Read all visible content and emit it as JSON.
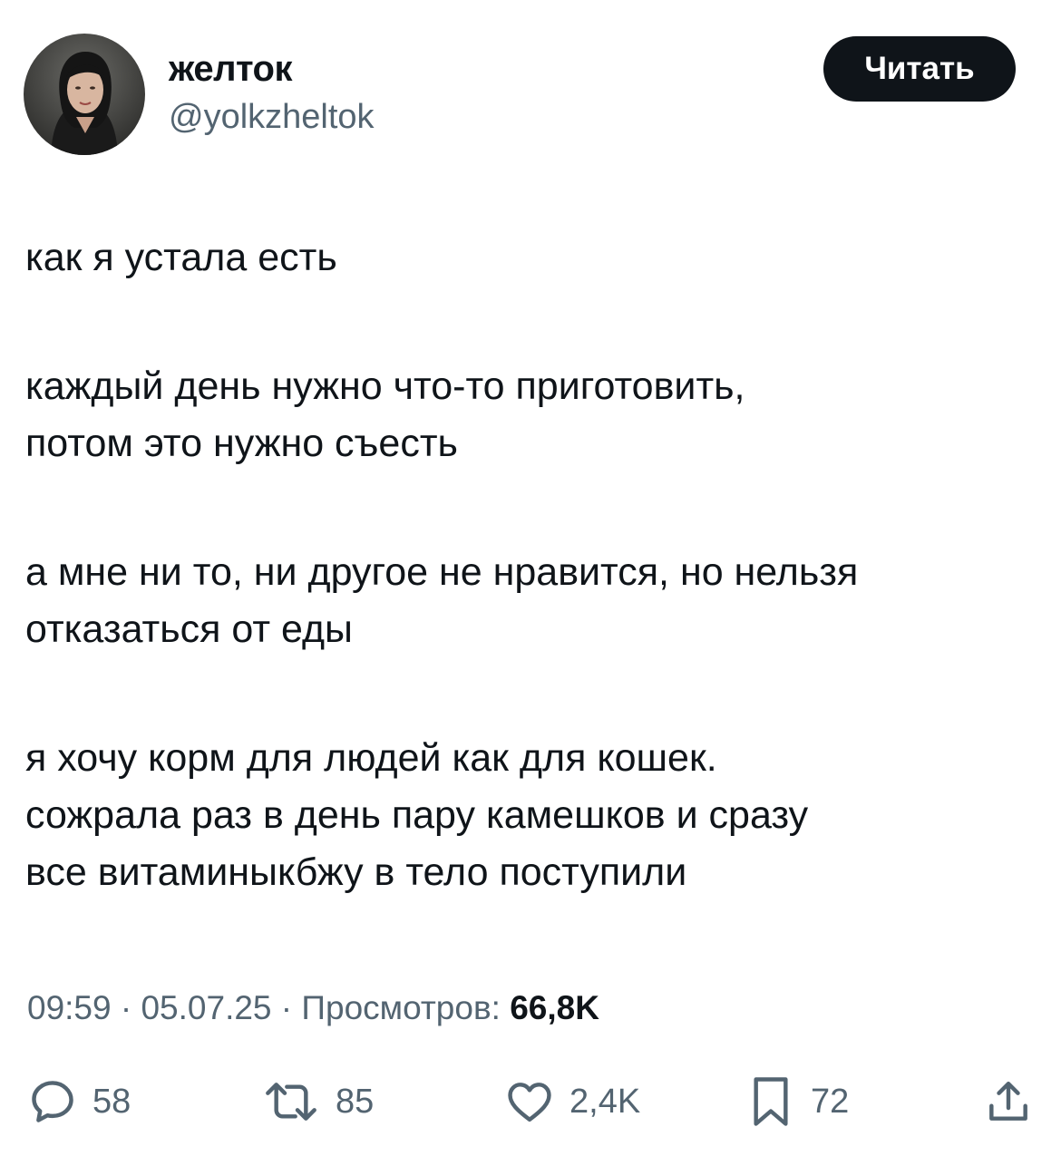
{
  "author": {
    "display_name": "желток",
    "handle": "@yolkzheltok",
    "avatar_icon": "user-avatar-photo"
  },
  "follow_button": {
    "label": "Читать"
  },
  "tweet": {
    "paragraphs": [
      {
        "lines": [
          "как я устала есть"
        ]
      },
      {
        "lines": [
          "каждый день нужно что-то приготовить,",
          "потом это нужно съесть"
        ]
      },
      {
        "lines": [
          "а мне ни то, ни другое не нравится, но нельзя",
          "отказаться от еды"
        ]
      },
      {
        "lines": [
          "я хочу корм для людей как для кошек.",
          "сожрала раз в день пару камешков и сразу",
          "все витаминыкбжу в тело поступили"
        ]
      }
    ]
  },
  "meta": {
    "time": "09:59",
    "separator": "·",
    "date": "05.07.25",
    "views_label": "Просмотров:",
    "views_count": "66,8K"
  },
  "actions": {
    "replies": {
      "icon": "reply-icon",
      "count": "58"
    },
    "reposts": {
      "icon": "repost-icon",
      "count": "85"
    },
    "likes": {
      "icon": "heart-icon",
      "count": "2,4K"
    },
    "bookmarks": {
      "icon": "bookmark-icon",
      "count": "72"
    },
    "share": {
      "icon": "share-icon"
    }
  },
  "colors": {
    "text_primary": "#0f1419",
    "text_secondary": "#536471",
    "button_bg": "#0f1419",
    "background": "#ffffff"
  }
}
